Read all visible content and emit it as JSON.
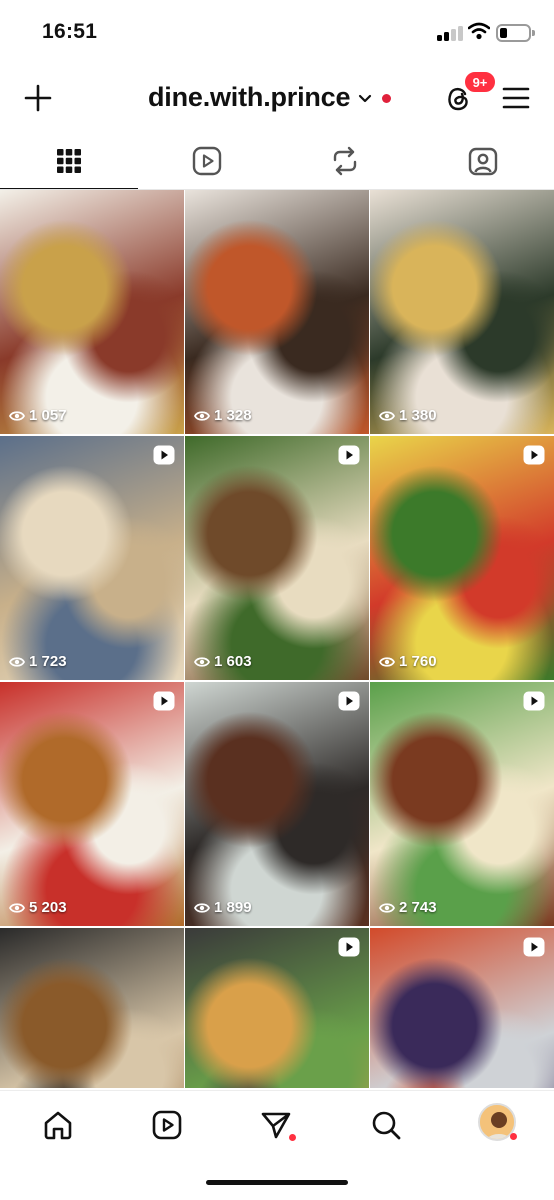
{
  "status_bar": {
    "time": "16:51",
    "signal_bars_active": 2,
    "signal_bars_total": 4,
    "battery_level": 0.2
  },
  "header": {
    "username": "dine.with.prince",
    "notification_badge": "9+",
    "live_dot_color": "#e0213b",
    "badge_color": "#ff3040",
    "icons": [
      "plus-icon",
      "chevron-down-icon",
      "threads-icon",
      "menu-icon"
    ]
  },
  "tabs": [
    {
      "name": "grid",
      "icon": "grid-icon",
      "active": true
    },
    {
      "name": "reels",
      "icon": "reels-icon",
      "active": false
    },
    {
      "name": "reposts",
      "icon": "repost-icon",
      "active": false
    },
    {
      "name": "tagged",
      "icon": "tagged-icon",
      "active": false
    }
  ],
  "posts": [
    {
      "views": "1 057",
      "reel": false,
      "colors": [
        "#c9a14a",
        "#8a3a2a",
        "#f3f0e8"
      ]
    },
    {
      "views": "1 328",
      "reel": false,
      "colors": [
        "#c0572a",
        "#3a2a20",
        "#e9e3dc"
      ]
    },
    {
      "views": "1 380",
      "reel": false,
      "colors": [
        "#d9b45a",
        "#2c3a2a",
        "#e9e0d5"
      ]
    },
    {
      "views": "1 723",
      "reel": true,
      "colors": [
        "#e7d9bf",
        "#c8b08a",
        "#5b6f8a"
      ]
    },
    {
      "views": "1 603",
      "reel": true,
      "colors": [
        "#6f4a2a",
        "#e8dcc0",
        "#3f6a2a"
      ]
    },
    {
      "views": "1 760",
      "reel": true,
      "colors": [
        "#3c7a2a",
        "#d23a2a",
        "#e9d54a"
      ]
    },
    {
      "views": "5 203",
      "reel": true,
      "colors": [
        "#b06a2a",
        "#f3efe6",
        "#c8302a"
      ]
    },
    {
      "views": "1 899",
      "reel": true,
      "colors": [
        "#5a3020",
        "#2e2a28",
        "#cfd6d2"
      ]
    },
    {
      "views": "2 743",
      "reel": true,
      "colors": [
        "#7a3a20",
        "#f0e6c8",
        "#5aa04a"
      ]
    },
    {
      "views": "",
      "reel": false,
      "colors": [
        "#8a5a2a",
        "#d8c6a8",
        "#2a2a2a"
      ]
    },
    {
      "views": "",
      "reel": true,
      "colors": [
        "#d9a04a",
        "#6aa04a",
        "#3a3a3a"
      ]
    },
    {
      "views": "",
      "reel": true,
      "colors": [
        "#3a2a5a",
        "#cfd2d6",
        "#d24a2a"
      ]
    }
  ],
  "bottom_nav": {
    "items": [
      "home-icon",
      "reels-icon",
      "send-icon",
      "search-icon",
      "profile-avatar"
    ],
    "notification_dot_color": "#ff3040"
  }
}
